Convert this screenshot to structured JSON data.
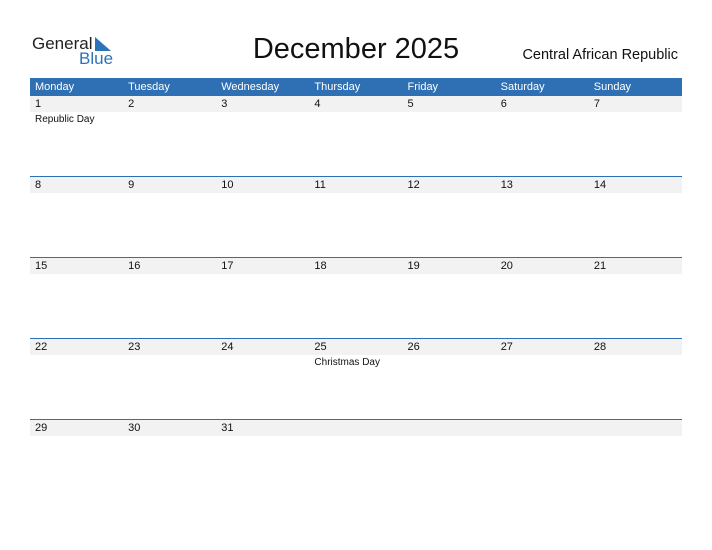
{
  "logo": {
    "line1": "General",
    "line2": "Blue"
  },
  "title": "December 2025",
  "country": "Central African Republic",
  "weekdays": [
    "Monday",
    "Tuesday",
    "Wednesday",
    "Thursday",
    "Friday",
    "Saturday",
    "Sunday"
  ],
  "colors": {
    "accent": "#2e70b3",
    "strip": "#f2f2f2"
  },
  "weeks": [
    [
      {
        "day": "1",
        "holiday": "Republic Day"
      },
      {
        "day": "2"
      },
      {
        "day": "3"
      },
      {
        "day": "4"
      },
      {
        "day": "5"
      },
      {
        "day": "6"
      },
      {
        "day": "7"
      }
    ],
    [
      {
        "day": "8"
      },
      {
        "day": "9"
      },
      {
        "day": "10"
      },
      {
        "day": "11"
      },
      {
        "day": "12"
      },
      {
        "day": "13"
      },
      {
        "day": "14"
      }
    ],
    [
      {
        "day": "15"
      },
      {
        "day": "16"
      },
      {
        "day": "17"
      },
      {
        "day": "18"
      },
      {
        "day": "19"
      },
      {
        "day": "20"
      },
      {
        "day": "21"
      }
    ],
    [
      {
        "day": "22"
      },
      {
        "day": "23"
      },
      {
        "day": "24"
      },
      {
        "day": "25",
        "holiday": "Christmas Day"
      },
      {
        "day": "26"
      },
      {
        "day": "27"
      },
      {
        "day": "28"
      }
    ],
    [
      {
        "day": "29"
      },
      {
        "day": "30"
      },
      {
        "day": "31"
      },
      {
        "day": ""
      },
      {
        "day": ""
      },
      {
        "day": ""
      },
      {
        "day": ""
      }
    ]
  ]
}
